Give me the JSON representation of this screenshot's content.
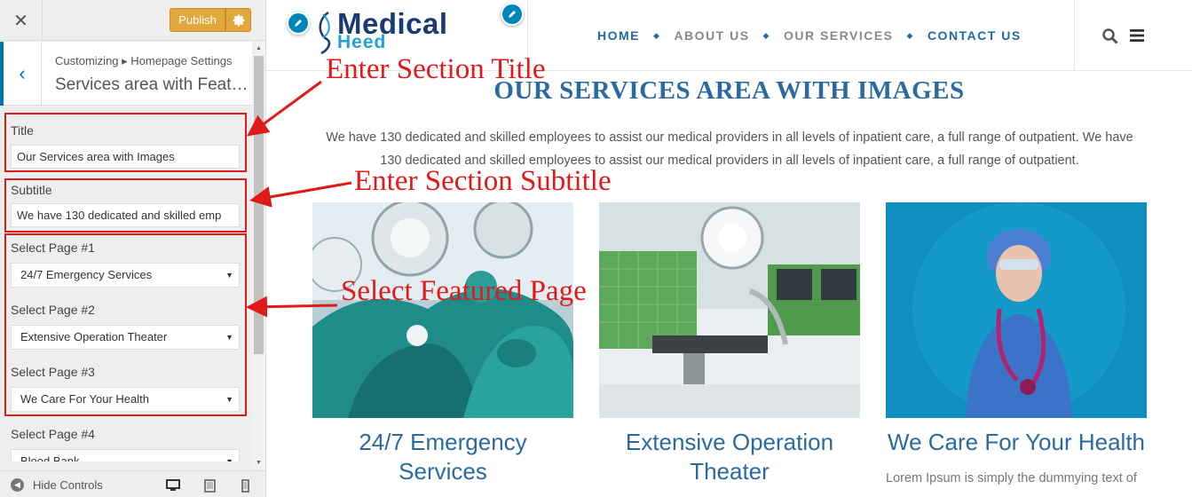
{
  "customizer": {
    "close_glyph": "✕",
    "publish_label": "Publish",
    "back_glyph": "‹",
    "breadcrumb": "Customizing ▸ Homepage Settings",
    "section_title": "Services area with Feat…",
    "title_label": "Title",
    "title_value": "Our Services area with Images",
    "subtitle_label": "Subtitle",
    "subtitle_value": "We have 130 dedicated and skilled emp",
    "page1_label": "Select Page #1",
    "page1_value": "24/7 Emergency Services",
    "page2_label": "Select Page #2",
    "page2_value": "Extensive Operation Theater",
    "page3_label": "Select Page #3",
    "page3_value": "We Care For Your Health",
    "page4_label": "Select Page #4",
    "page4_value": "Blood Bank",
    "hide_controls": "Hide Controls"
  },
  "site": {
    "logo_top": "Medical",
    "logo_bottom": "Heed",
    "nav": [
      "HOME",
      "ABOUT US",
      "OUR SERVICES",
      "CONTACT US"
    ]
  },
  "services": {
    "title": "OUR SERVICES AREA WITH IMAGES",
    "subtitle": "We have 130 dedicated and skilled employees to assist our medical providers in all levels of inpatient care, a full range of outpatient. We have 130 dedicated and skilled employees to assist our medical providers in all levels of inpatient care, a full range of outpatient.",
    "cards": [
      {
        "title": "24/7 Emergency Services"
      },
      {
        "title": "Extensive Operation Theater"
      },
      {
        "title": "We Care For Your Health",
        "desc": "Lorem Ipsum is simply the dummying text of"
      }
    ]
  },
  "annotations": {
    "title": "Enter Section Title",
    "subtitle": "Enter Section Subtitle",
    "pages": "Select Featured Page"
  },
  "colors": {
    "accent": "#0073aa",
    "publish": "#e0a73c",
    "brand_blue": "#2a6aa0",
    "annotation_red": "#e01a1a"
  }
}
